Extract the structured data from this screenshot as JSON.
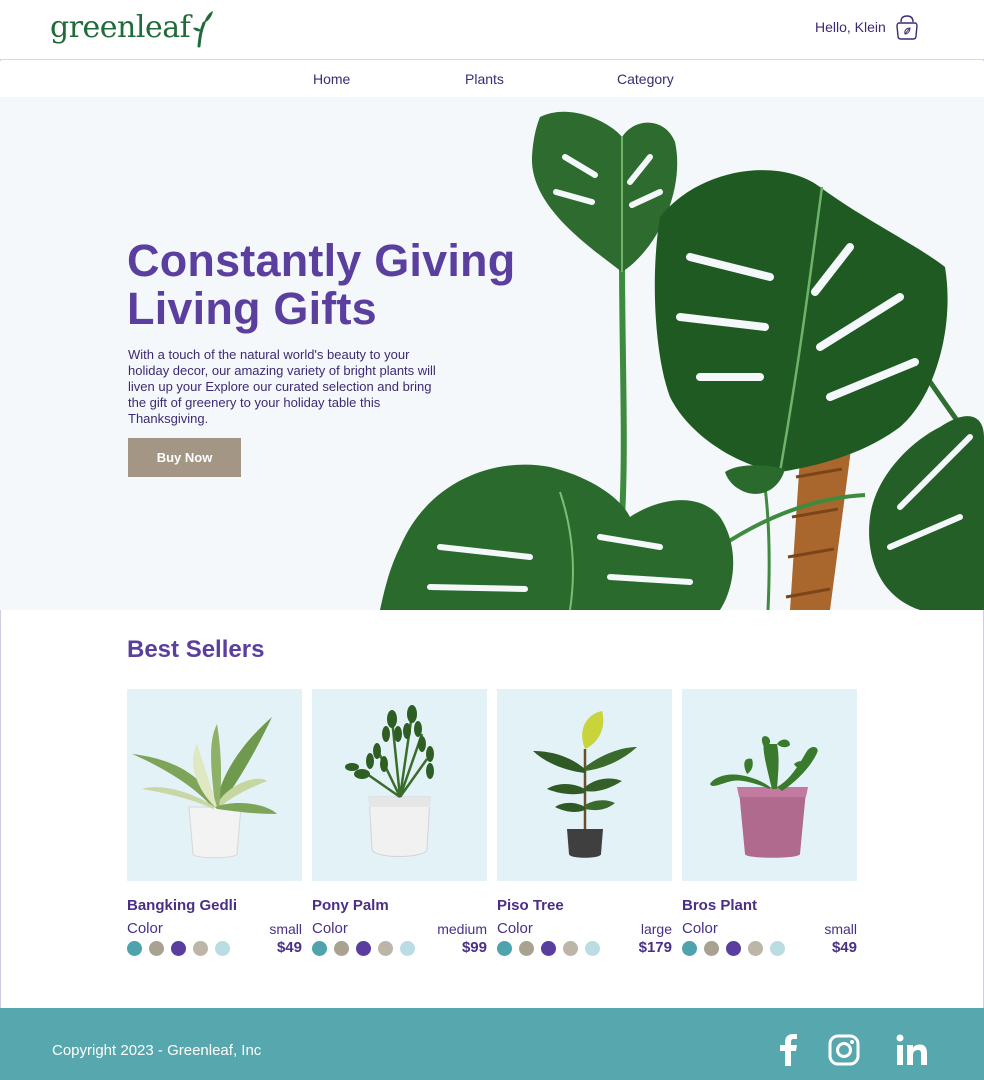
{
  "header": {
    "logo": "greenleaf",
    "greeting": "Hello, Klein"
  },
  "nav": {
    "items": [
      "Home",
      "Plants",
      "Category"
    ]
  },
  "hero": {
    "title_line1": "Constantly Giving",
    "title_line2": "Living Gifts",
    "description": "With a touch of the natural world's beauty to your holiday decor, our amazing variety of bright plants will liven up your Explore our curated selection and bring the gift of greenery to your holiday table this Thanksgiving.",
    "cta": "Buy Now"
  },
  "best_sellers": {
    "title": "Best Sellers",
    "color_label": "Color",
    "products": [
      {
        "name": "Bangking Gedli",
        "size": "small",
        "price": "$49"
      },
      {
        "name": "Pony Palm",
        "size": "medium",
        "price": "$99"
      },
      {
        "name": "Piso Tree",
        "size": "large",
        "price": "$179"
      },
      {
        "name": "Bros Plant",
        "size": "small",
        "price": "$49"
      }
    ],
    "swatch_colors": [
      "#4fa3ad",
      "#a9a291",
      "#5a3e9f",
      "#bdb5a8",
      "#b9dde3"
    ]
  },
  "footer": {
    "copyright": "Copyright 2023 - Greenleaf, Inc",
    "social": [
      "facebook-icon",
      "instagram-icon",
      "linkedin-icon"
    ]
  },
  "colors": {
    "brand_purple": "#5b3f9e",
    "logo_green": "#1f6b3a",
    "button": "#a39684",
    "footer": "#56a7ae",
    "card_bg": "#e3f2f7"
  }
}
